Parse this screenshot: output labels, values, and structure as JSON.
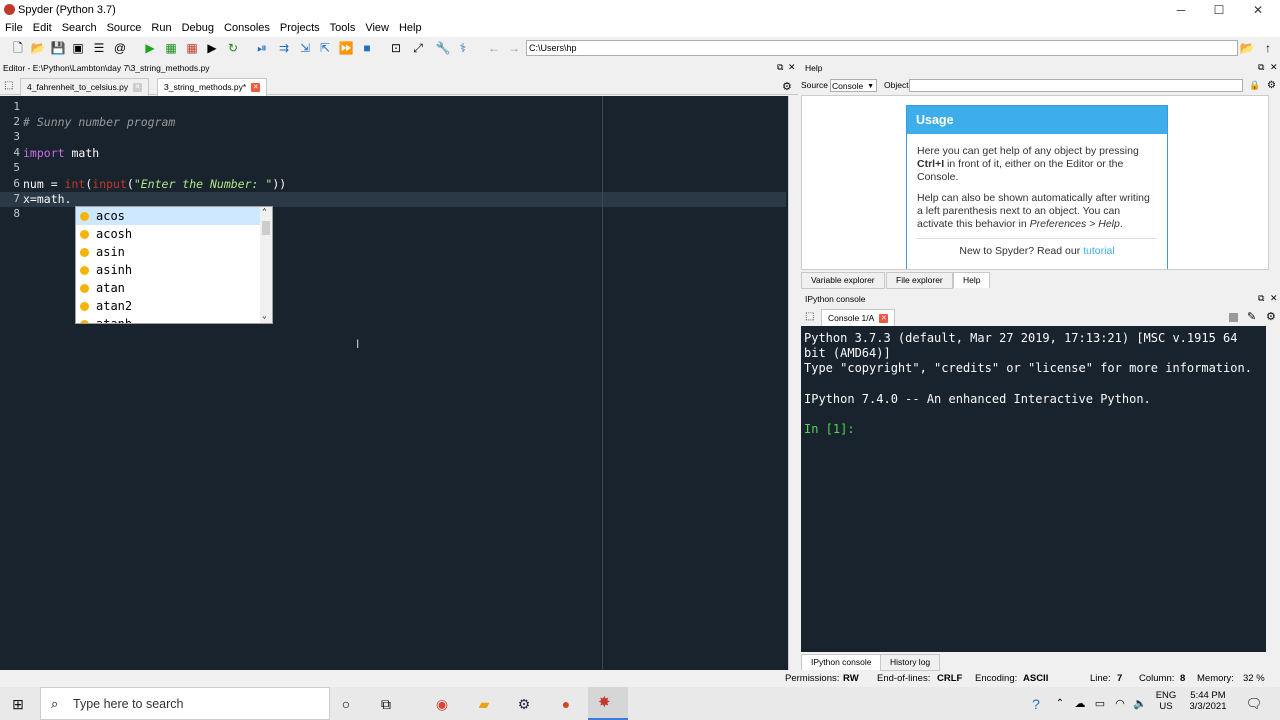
{
  "window": {
    "title": "Spyder (Python 3.7)",
    "minimize": "─",
    "maximize": "☐",
    "close": "✕"
  },
  "menu": [
    "File",
    "Edit",
    "Search",
    "Source",
    "Run",
    "Debug",
    "Consoles",
    "Projects",
    "Tools",
    "View",
    "Help"
  ],
  "toolbar": {
    "path": "C:\\Users\\hp"
  },
  "editor": {
    "header": "Editor - E:\\Python\\Lambton\\day 7\\3_string_methods.py",
    "tabs": [
      {
        "label": "4_fahrenheit_to_celsius.py"
      },
      {
        "label": "3_string_methods.py*"
      }
    ],
    "lines": [
      "1",
      "2",
      "3",
      "4",
      "5",
      "6",
      "7",
      "8"
    ],
    "code": {
      "l2": "# Sunny number program",
      "l4_kw": "import",
      "l4_rest": " math",
      "l6_a": "num = ",
      "l6_int": "int",
      "l6_p1": "(",
      "l6_input": "input",
      "l6_p2": "(",
      "l6_str": "\"Enter the Number: \"",
      "l6_p3": "))",
      "l7": "x=math."
    }
  },
  "completion": {
    "items": [
      "acos",
      "acosh",
      "asin",
      "asinh",
      "atan",
      "atan2",
      "atanh"
    ]
  },
  "help": {
    "header": "Help",
    "source_label": "Source",
    "source_value": "Console",
    "object_label": "Object",
    "card_title": "Usage",
    "p1_a": "Here you can get help of any object by pressing ",
    "p1_b": "Ctrl+I",
    "p1_c": " in front of it, either on the Editor or the Console.",
    "p2_a": "Help can also be shown automatically after writing a left parenthesis next to an object. You can activate this behavior in ",
    "p2_b": "Preferences > Help",
    "p2_c": ".",
    "p3_a": "New to Spyder? Read our ",
    "p3_b": "tutorial",
    "tabs": [
      "Variable explorer",
      "File explorer",
      "Help"
    ]
  },
  "console": {
    "header": "IPython console",
    "tab": "Console 1/A",
    "lines": [
      "Python 3.7.3 (default, Mar 27 2019, 17:13:21) [MSC v.1915 64",
      "bit (AMD64)]",
      "Type \"copyright\", \"credits\" or \"license\" for more information.",
      "",
      "IPython 7.4.0 -- An enhanced Interactive Python.",
      "",
      "In [1]:"
    ],
    "bottom_tabs": [
      "IPython console",
      "History log"
    ]
  },
  "status": {
    "permissions_label": "Permissions:",
    "permissions": "RW",
    "eol_label": "End-of-lines:",
    "eol": "CRLF",
    "encoding_label": "Encoding:",
    "encoding": "ASCII",
    "line_label": "Line:",
    "line": "7",
    "column_label": "Column:",
    "column": "8",
    "memory_label": "Memory:",
    "memory": "32 %"
  },
  "taskbar": {
    "search_placeholder": "Type here to search",
    "lang": "ENG",
    "region": "US",
    "time": "5:44 PM",
    "date": "3/3/2021"
  },
  "colors": {
    "accent": "#3daee9",
    "editor_bg": "#19232d",
    "prompt": "#54d454"
  }
}
